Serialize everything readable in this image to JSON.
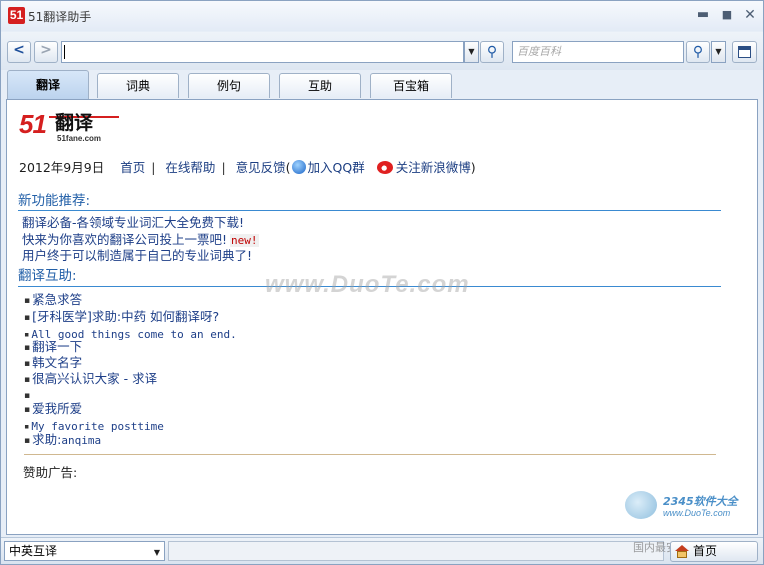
{
  "window": {
    "title": "51翻译助手",
    "logo_text": "51"
  },
  "toolbar": {
    "back_label": "<",
    "forward_label": ">",
    "url_value": "",
    "search_placeholder": "百度百科"
  },
  "tabs": [
    {
      "label": "翻译",
      "active": true
    },
    {
      "label": "词典",
      "active": false
    },
    {
      "label": "例句",
      "active": false
    },
    {
      "label": "互助",
      "active": false
    },
    {
      "label": "百宝箱",
      "active": false
    }
  ],
  "content": {
    "logo": {
      "number": "51",
      "name": "翻译",
      "domain": "51fane.com"
    },
    "nav": {
      "date": "2012年9月9日",
      "home": "首页",
      "help": "在线帮助",
      "feedback": "意见反馈",
      "paren_open": "(",
      "qq_group": "加入QQ群",
      "weibo": "关注新浪微博",
      "paren_close": ")"
    },
    "features": {
      "heading": "新功能推荐:",
      "items": [
        {
          "text": "翻译必备-各领域专业词汇大全免费下载!"
        },
        {
          "text": "快来为你喜欢的翻译公司投上一票吧!",
          "badge": "new!"
        },
        {
          "text": "用户终于可以制造属于自己的专业词典了!"
        }
      ]
    },
    "qa": {
      "heading": "翻译互助:",
      "items": [
        {
          "text": "紧急求答"
        },
        {
          "text": "[牙科医学]求助:中药 如何翻译呀?"
        },
        {
          "text": "All good things come to an end."
        },
        {
          "text": "翻译一下"
        },
        {
          "text": "韩文名字"
        },
        {
          "text": "很高兴认识大家 - 求译"
        },
        {
          "text": ""
        },
        {
          "text": "爱我所爱"
        },
        {
          "text": "My favorite posttime"
        },
        {
          "text_cn": "求助:",
          "text_en": "anqima"
        }
      ]
    },
    "ad_label": "赞助广告:"
  },
  "watermarks": {
    "center": "www.DuoTe.com",
    "corner_brand": "2345软件大全",
    "corner_url": "www.DuoTe.com",
    "corner_note": "国内最安全的软件站"
  },
  "statusbar": {
    "language": "中英互译",
    "home_label": "首页"
  }
}
